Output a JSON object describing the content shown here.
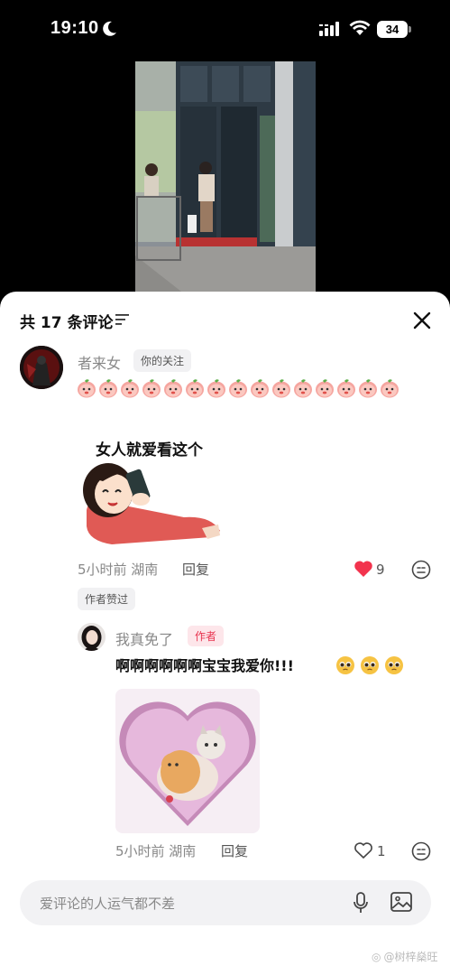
{
  "status_bar": {
    "time": "19:10",
    "battery": "34"
  },
  "comments_header": {
    "title": "共 17 条评论"
  },
  "comment_1": {
    "username": "者来女",
    "follow_badge": "你的关注",
    "emoji_count": 15,
    "sticker_caption": "女人就爱看这个",
    "meta": "5小时前 湖南",
    "reply_label": "回复",
    "likes": "9",
    "author_liked": "作者赞过"
  },
  "comment_2": {
    "username": "我真免了",
    "author_badge": "作者",
    "text": "啊啊啊啊啊啊宝宝我爱你!!!",
    "meta": "5小时前 湖南",
    "reply_label": "回复",
    "likes": "1"
  },
  "input": {
    "placeholder": "爱评论的人运气都不差"
  },
  "watermark": "@树梓燊旺",
  "icons": [
    "moon-icon",
    "signal-icon",
    "wifi-icon",
    "filter-icon",
    "close-icon",
    "heart-filled-icon",
    "heart-outline-icon",
    "more-icon",
    "mic-icon",
    "image-icon",
    "peach-emoji-icon",
    "pleading-emoji-icon"
  ],
  "colors": {
    "like_red": "#f2334d",
    "author_badge_bg": "#fde6ea",
    "author_badge_text": "#e8334f"
  }
}
